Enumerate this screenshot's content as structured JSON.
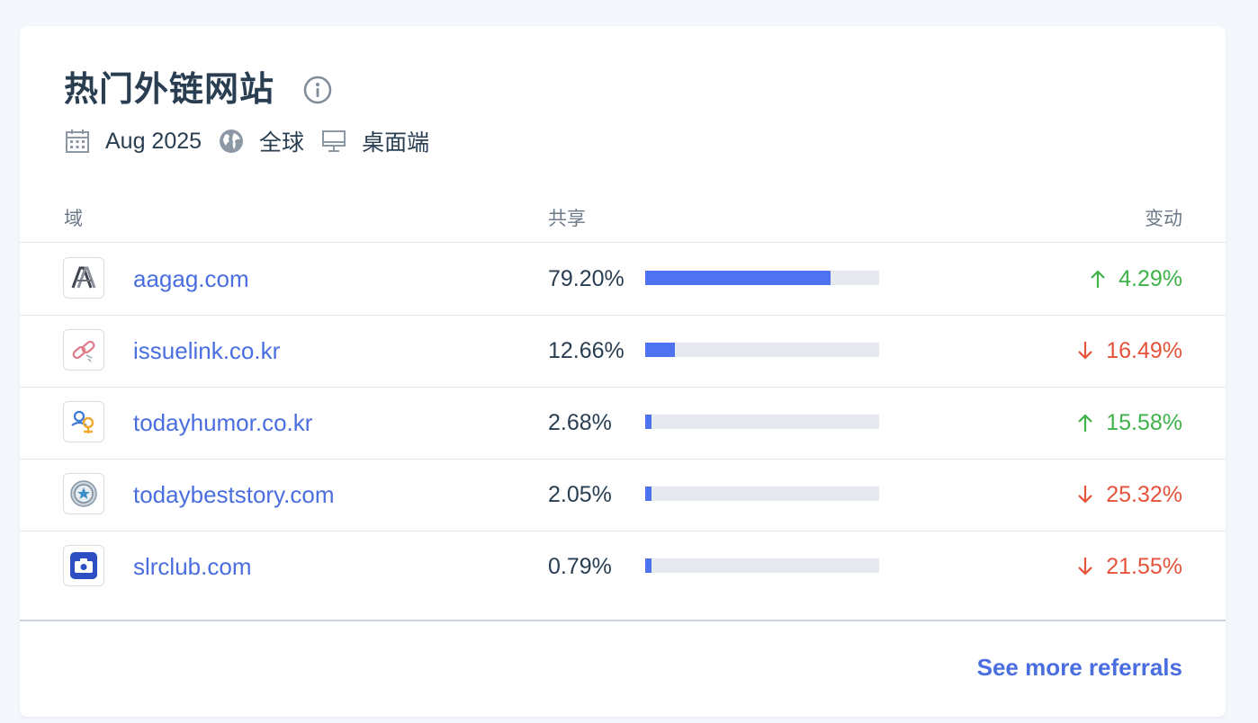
{
  "header": {
    "title": "热门外链网站"
  },
  "meta": {
    "date": "Aug 2025",
    "region": "全球",
    "device": "桌面端"
  },
  "columns": {
    "domain": "域",
    "share": "共享",
    "change": "变动"
  },
  "rows": [
    {
      "domain": "aagag.com",
      "share": "79.20%",
      "share_fraction": 0.792,
      "change": "4.29%",
      "direction": "up",
      "favicon": "aagag-logo-icon"
    },
    {
      "domain": "issuelink.co.kr",
      "share": "12.66%",
      "share_fraction": 0.1266,
      "change": "16.49%",
      "direction": "down",
      "favicon": "chain-link-icon"
    },
    {
      "domain": "todayhumor.co.kr",
      "share": "2.68%",
      "share_fraction": 0.0268,
      "change": "15.58%",
      "direction": "up",
      "favicon": "todayhumor-logo-icon"
    },
    {
      "domain": "todaybeststory.com",
      "share": "2.05%",
      "share_fraction": 0.0205,
      "change": "25.32%",
      "direction": "down",
      "favicon": "star-badge-icon"
    },
    {
      "domain": "slrclub.com",
      "share": "0.79%",
      "share_fraction": 0.0079,
      "change": "21.55%",
      "direction": "down",
      "favicon": "camera-icon"
    }
  ],
  "footer": {
    "see_more": "See more referrals"
  },
  "colors": {
    "link": "#4a6ee0",
    "bar": "#4f73f0",
    "track": "#e6e9ee",
    "up": "#3fb24a",
    "down": "#e4533a"
  }
}
